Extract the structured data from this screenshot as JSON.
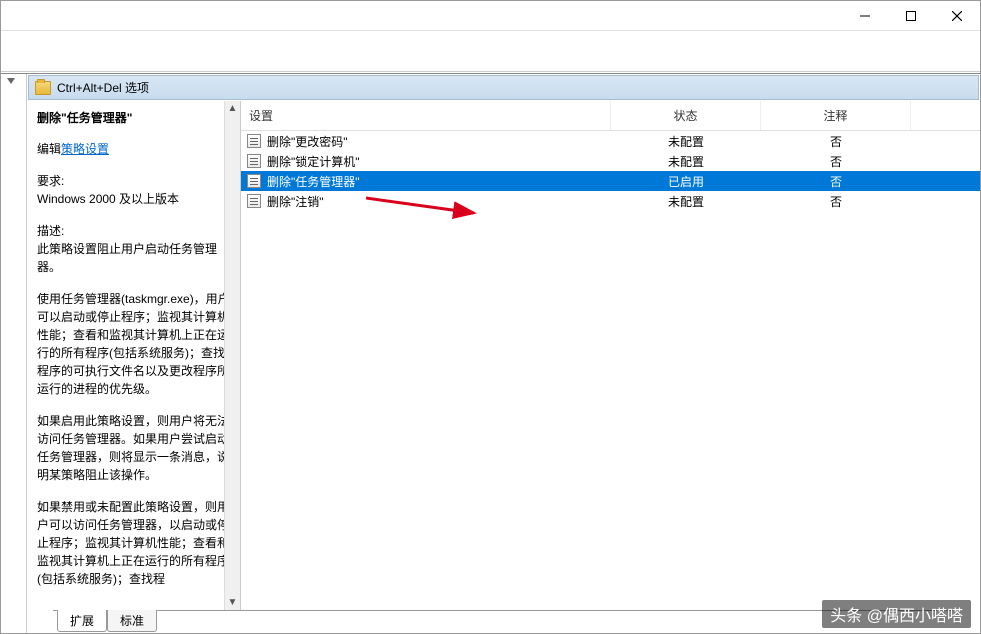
{
  "title": "Ctrl+Alt+Del 选项",
  "policy_title": "删除\"任务管理器\"",
  "edit_prefix": "编辑",
  "edit_link": "策略设置",
  "req_label": "要求:",
  "req_text": "Windows 2000 及以上版本",
  "desc_label": "描述:",
  "desc_p1": "此策略设置阻止用户启动任务管理器。",
  "desc_p2": "使用任务管理器(taskmgr.exe)，用户可以启动或停止程序；监视其计算机性能；查看和监视其计算机上正在运行的所有程序(包括系统服务)；查找程序的可执行文件名以及更改程序所运行的进程的优先级。",
  "desc_p3": "如果启用此策略设置，则用户将无法访问任务管理器。如果用户尝试启动任务管理器，则将显示一条消息，说明某策略阻止该操作。",
  "desc_p4": "如果禁用或未配置此策略设置，则用户可以访问任务管理器，以启动或停止程序；监视其计算机性能；查看和监视其计算机上正在运行的所有程序(包括系统服务)；查找程",
  "columns": {
    "setting": "设置",
    "state": "状态",
    "note": "注释"
  },
  "rows": [
    {
      "label": "删除\"更改密码\"",
      "state": "未配置",
      "note": "否",
      "selected": false
    },
    {
      "label": "删除\"锁定计算机\"",
      "state": "未配置",
      "note": "否",
      "selected": false
    },
    {
      "label": "删除\"任务管理器\"",
      "state": "已启用",
      "note": "否",
      "selected": true
    },
    {
      "label": "删除\"注销\"",
      "state": "未配置",
      "note": "否",
      "selected": false
    }
  ],
  "tabs": {
    "extended": "扩展",
    "standard": "标准"
  },
  "watermark": "头条 @偶西小嗒嗒"
}
